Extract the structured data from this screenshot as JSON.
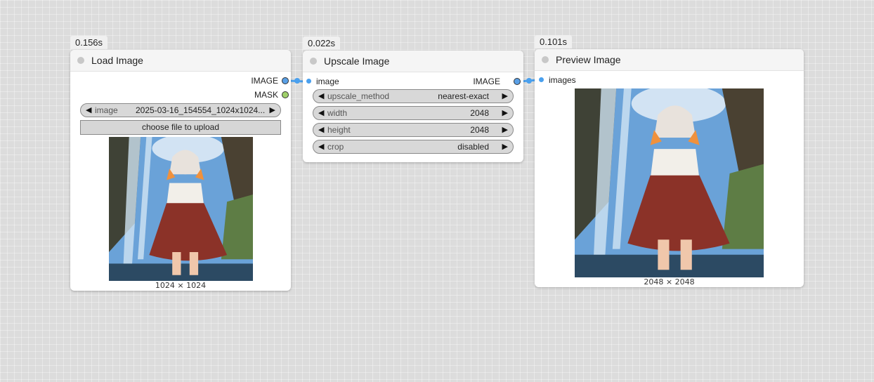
{
  "nodes": {
    "load_image": {
      "timing": "0.156s",
      "title": "Load Image",
      "outputs": [
        "IMAGE",
        "MASK"
      ],
      "widget": {
        "name": "image",
        "value": "2025-03-16_154554_1024x1024..."
      },
      "upload_label": "choose file to upload",
      "image_caption": "1024 × 1024"
    },
    "upscale_image": {
      "timing": "0.022s",
      "title": "Upscale Image",
      "input": "image",
      "output": "IMAGE",
      "widgets": [
        {
          "name": "upscale_method",
          "value": "nearest-exact"
        },
        {
          "name": "width",
          "value": "2048"
        },
        {
          "name": "height",
          "value": "2048"
        },
        {
          "name": "crop",
          "value": "disabled"
        }
      ]
    },
    "preview_image": {
      "timing": "0.101s",
      "title": "Preview Image",
      "input": "images",
      "image_caption": "2048 × 2048"
    }
  },
  "icons": {
    "arrow_left": "◀",
    "arrow_right": "▶"
  },
  "colors": {
    "link": "#4aa0ee",
    "image_port": "#5aa0e6",
    "mask_port": "#9fd06a",
    "canvas": "#dcdcdc"
  }
}
